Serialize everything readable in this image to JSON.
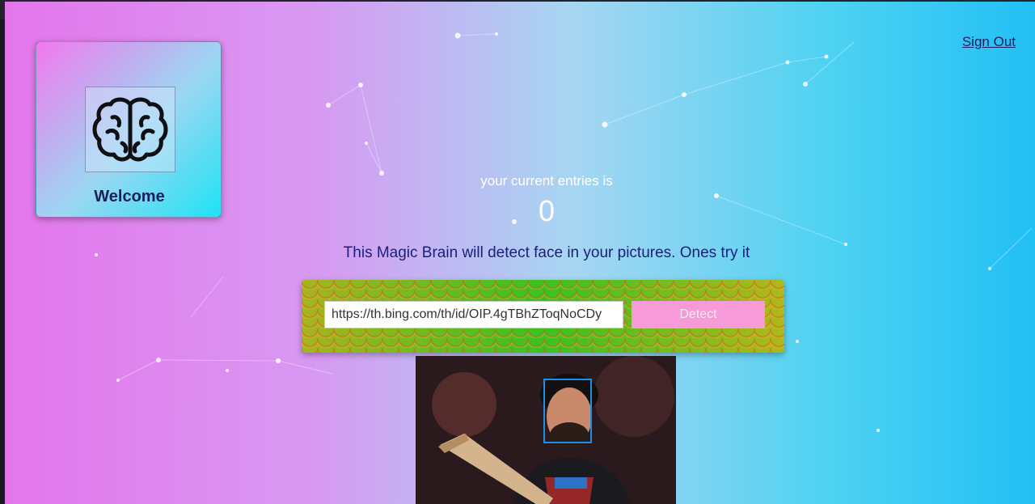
{
  "browser": {
    "toolbar_icons": [
      "read-aloud-icon",
      "favorite-icon",
      "extensions-icon",
      "favorites-icon",
      "collections-icon",
      "profile-icon"
    ]
  },
  "app": {
    "logo": {
      "icon": "brain-icon",
      "label": "Welcome"
    },
    "nav": {
      "signout_label": "Sign Out"
    },
    "rank": {
      "label": "your current entries is",
      "count": "0"
    },
    "tagline": "This Magic Brain will detect face in your pictures. Ones try it",
    "form": {
      "url_value": "https://th.bing.com/th/id/OIP.4gTBhZToqNoCDy",
      "detect_label": "Detect"
    },
    "result": {
      "image": "face-detection-result-image",
      "faces_detected": 1
    }
  },
  "colors": {
    "background_left": "#e476ec",
    "background_right": "#22c0f5",
    "detect_button": "#f79ad8",
    "face_box": "#1e8fe6",
    "tagline_text": "#1c1f7a"
  }
}
